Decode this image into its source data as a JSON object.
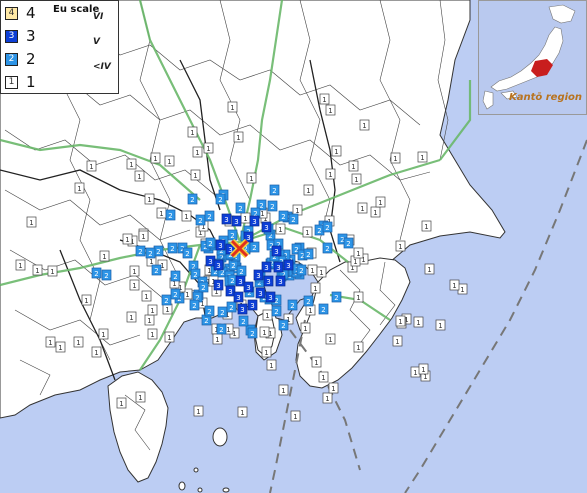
{
  "legend": {
    "scale_title": "Eu scale",
    "items": [
      {
        "level": "4",
        "eu": "VI",
        "color": "#ffe9a6",
        "text_color": "#333333"
      },
      {
        "level": "3",
        "eu": "V",
        "color": "#0d3fd6",
        "text_color": "#ffffff"
      },
      {
        "level": "2",
        "eu": "<IV",
        "color": "#2d94e6",
        "text_color": "#ffffff"
      },
      {
        "level": "1",
        "eu": "",
        "color": "#ffffff",
        "text_color": "#333333"
      }
    ]
  },
  "inset": {
    "label": "Kantō region",
    "sea_color": "#b9c9ef",
    "land_color": "#ffffff",
    "highlight_color": "#c81e1e"
  },
  "colors": {
    "sea": "#bccdf3",
    "land": "#ffffff",
    "boundary": "#333333",
    "road": "#6ab86a",
    "trench": "#777777",
    "epicenter": "#e0301e"
  }
}
